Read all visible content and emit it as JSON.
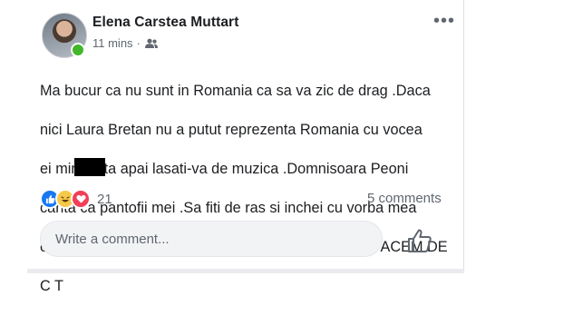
{
  "post": {
    "author": "Elena Carstea Muttart",
    "time": "11 mins",
    "separator": "·",
    "audience_icon": "friends-icon",
    "more_icon": "•••",
    "text_lines": [
      "Ma bucur ca nu sunt in Romania ca sa va zic de drag .Daca",
      "nici Laura Bretan nu a putut reprezenta Romania  cu vocea",
      "ei minunata  apai lasati-va de muzica .Domnisoara Peoni",
      "canta ca pantofii mei .Sa fiti de ras si inchei cu vorba mea",
      "celebra .SA NU PIERDEM NICI O OCAZIE SA NE FACEM DE",
      "C      T"
    ]
  },
  "reactions": {
    "icons": [
      "like-reaction-icon",
      "haha-reaction-icon",
      "love-reaction-icon"
    ],
    "count": "21",
    "comments": "5 comments"
  },
  "composer": {
    "placeholder": "Write a comment..."
  },
  "colors": {
    "like": "#1877f2",
    "haha": "#f7c948",
    "love": "#f33e58",
    "online": "#42b72a",
    "meta_text": "#606770"
  }
}
